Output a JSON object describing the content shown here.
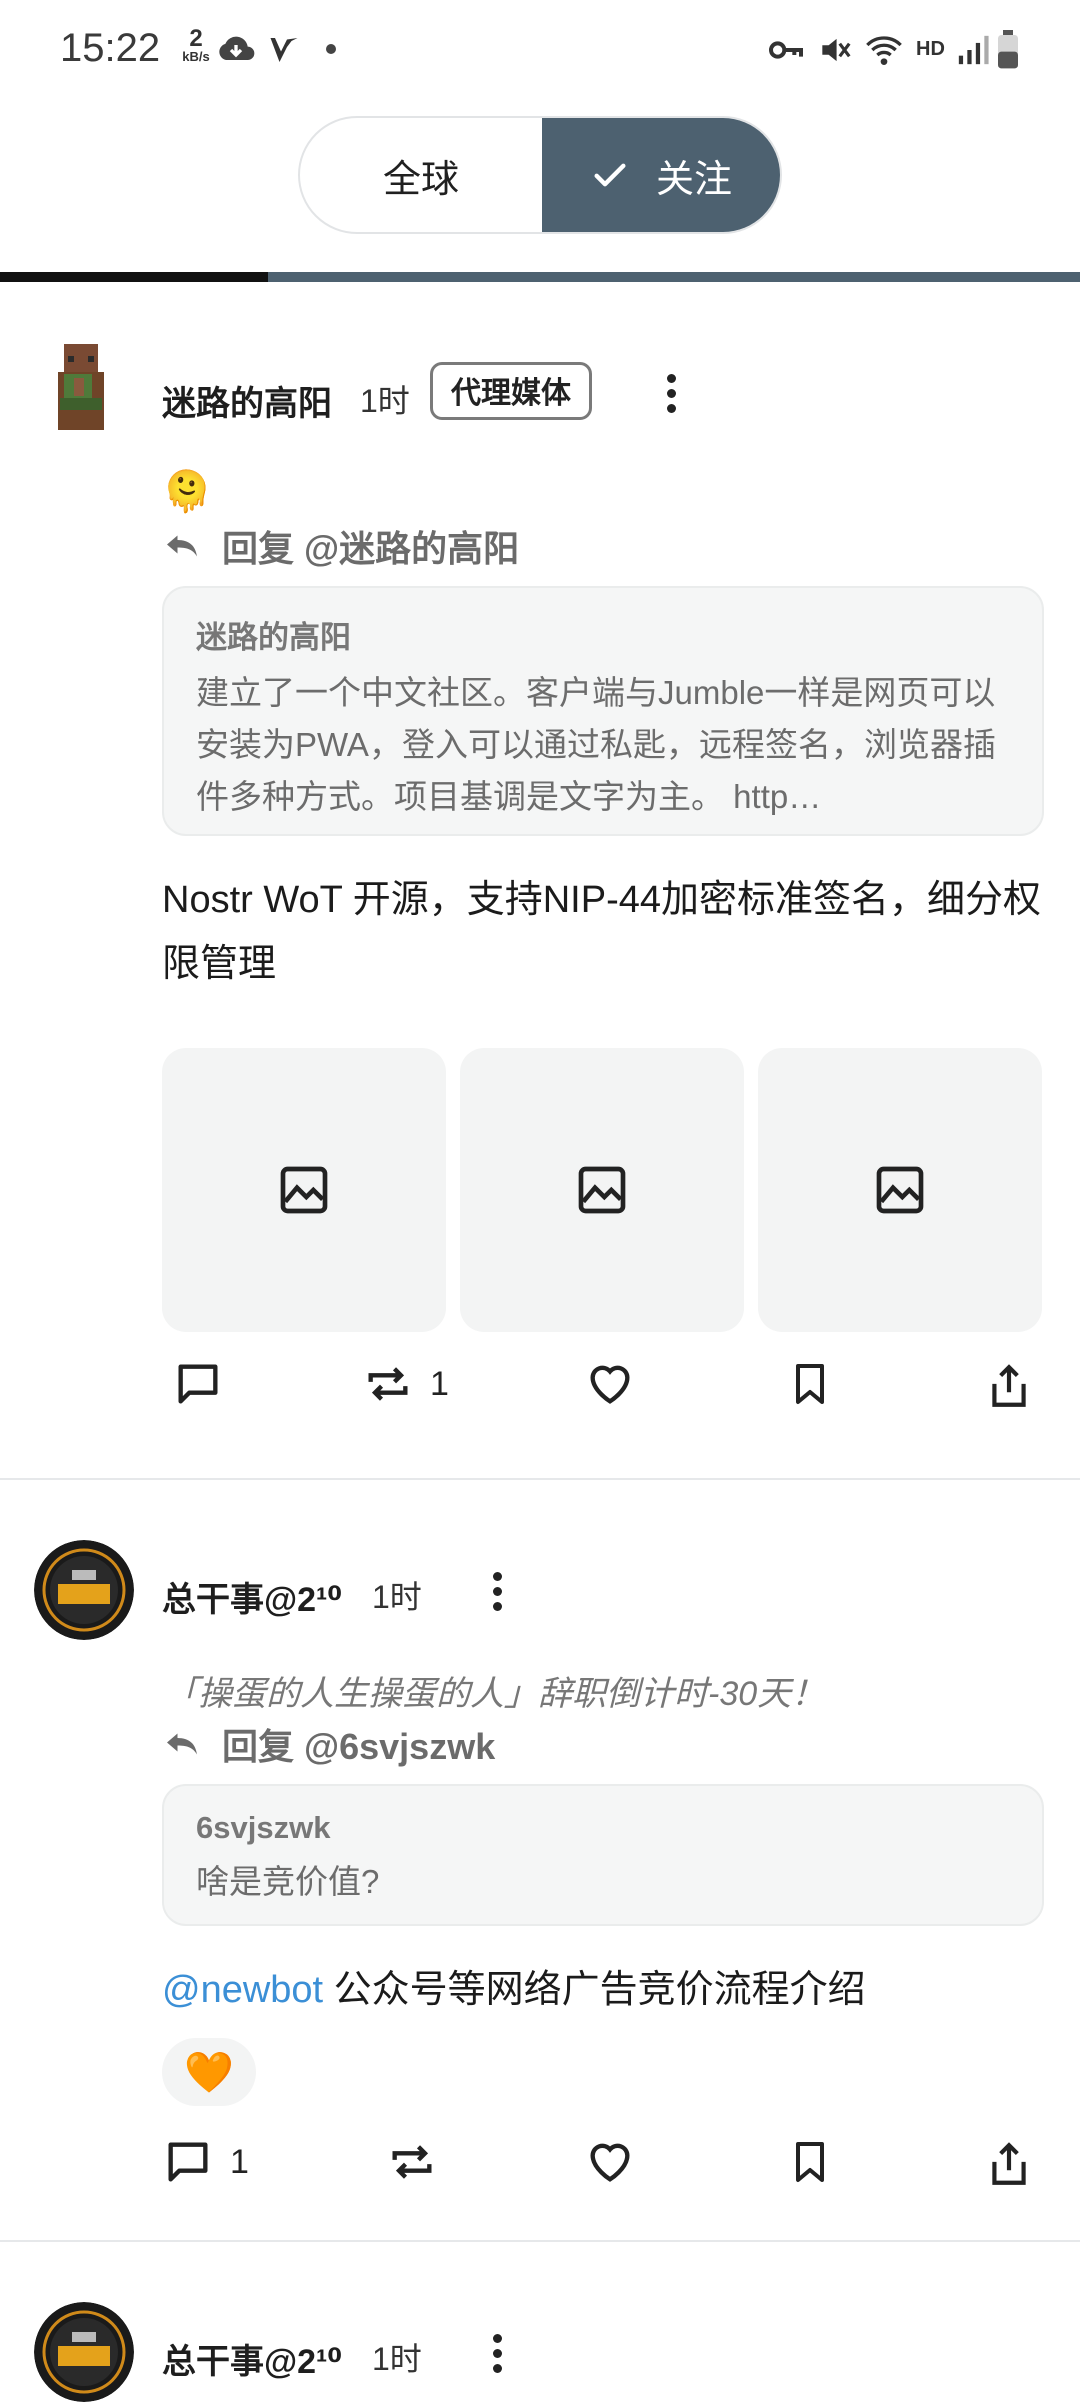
{
  "status_bar": {
    "time": "15:22",
    "net_speed_value": "2",
    "net_speed_unit": "kB/s",
    "hd_label": "HD",
    "icons": [
      "cloud-download-icon",
      "v-app-icon",
      "dot-icon",
      "vpn-key-icon",
      "mute-icon",
      "wifi-6-icon",
      "signal-icon",
      "battery-icon"
    ]
  },
  "segment": {
    "global_label": "全球",
    "following_label": "关注",
    "selected": "following"
  },
  "colors": {
    "accent": "#4d6170",
    "mention": "#3b8fd6",
    "quote_bg": "#f5f6f6"
  },
  "posts": [
    {
      "author": "迷路的高阳",
      "time": "1时",
      "badge": "代理媒体",
      "emoji": "🫠",
      "reply_to": "回复 @迷路的高阳",
      "quote": {
        "name": "迷路的高阳",
        "text": "建立了一个中文社区。客户端与Jumble一样是网页可以安装为PWA，登入可以通过私匙，远程签名，浏览器插件多种方式。项目基调是文字为主。 http…"
      },
      "content": "Nostr WoT 开源，支持NIP-44加密标准签名，细分权限管理",
      "images": [
        "image-placeholder-icon",
        "image-placeholder-icon",
        "image-placeholder-icon"
      ],
      "actions": {
        "reply_count": "",
        "repost_count": "1"
      }
    },
    {
      "author": "总干事@2¹⁰",
      "time": "1时",
      "subtitle": "「操蛋的人生操蛋的人」辞职倒计时-30天！",
      "reply_to": "回复 @6svjszwk",
      "quote": {
        "name": "6svjszwk",
        "text": "啥是竞价值?"
      },
      "mention": "@newbot",
      "content": " 公众号等网络广告竞价流程介绍",
      "reaction": "🧡",
      "actions": {
        "reply_count": "1",
        "repost_count": ""
      }
    },
    {
      "author": "总干事@2¹⁰",
      "time": "1时"
    }
  ]
}
